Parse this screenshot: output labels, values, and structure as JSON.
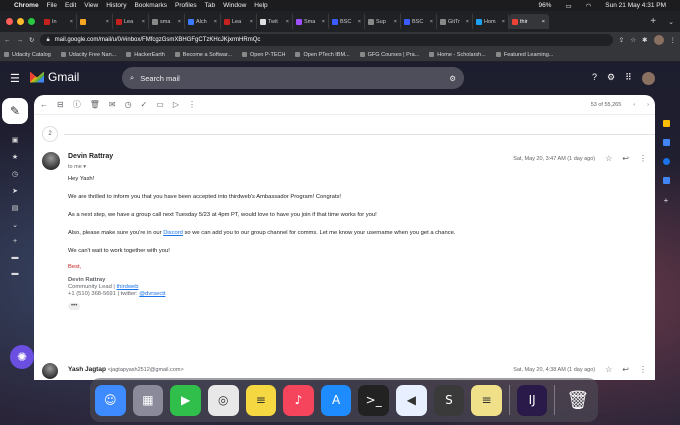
{
  "menubar": {
    "app": "Chrome",
    "items": [
      "File",
      "Edit",
      "View",
      "History",
      "Bookmarks",
      "Profiles",
      "Tab",
      "Window",
      "Help"
    ],
    "battery": "96%",
    "datetime": "Sun 21 May  4:31 PM"
  },
  "tabs": [
    {
      "label": "In",
      "color": "#c5221f"
    },
    {
      "label": "",
      "color": "#f5a623"
    },
    {
      "label": "Lea",
      "color": "#c5221f"
    },
    {
      "label": "sma",
      "color": "#888888"
    },
    {
      "label": "Alch",
      "color": "#3b7bff"
    },
    {
      "label": "Lea",
      "color": "#c5221f"
    },
    {
      "label": "Twit",
      "color": "#e0e0e0"
    },
    {
      "label": "Sma",
      "color": "#a050ff"
    },
    {
      "label": "BSC",
      "color": "#3b5bff"
    },
    {
      "label": "Sup",
      "color": "#888888"
    },
    {
      "label": "BSC",
      "color": "#3b5bff"
    },
    {
      "label": "GitTr",
      "color": "#888888"
    },
    {
      "label": "Hom",
      "color": "#1da1f2"
    },
    {
      "label": "thir",
      "color": "#ea4335",
      "active": true
    }
  ],
  "address": {
    "url": "mail.google.com/mail/u/0/#inbox/FMfcgzGsmXBHGFgCTzKHcJKjxrmHRmQc"
  },
  "bookmarks": [
    "Udacity Catalog",
    "Udacity Free Nan...",
    "HackerEarth",
    "Become a Softwar...",
    "Open P-TECH",
    "Open PTech IBM...",
    "GFG Courses | Pra...",
    "Home - Scholarsh...",
    "Featured Learning..."
  ],
  "gmail": {
    "brand": "Gmail",
    "search_placeholder": "Search mail",
    "pagination": "53 of 55,265",
    "collapsed_count": "2"
  },
  "message": {
    "sender": "Devin Rattray",
    "to": "to me",
    "date": "Sat, May 20, 3:47 AM (1 day ago)",
    "greeting": "Hey Yash!",
    "p1": "We are thrilled to inform you that you have been accepted into thirdweb's Ambassador Program! Congrats!",
    "p2": "As a next step, we have a group call next Tuesday 5/23 at 4pm PT, would love to have you join if that time works for you!",
    "p3_before": "Also, please make sure you're in our ",
    "p3_link": "Discord",
    "p3_after": " so we can add you to our group channel for comms. Let me know your username when you get a chance.",
    "p4": "We can't wait to work together with you!",
    "closing": "Best,",
    "sig_name": "Devin Rattray",
    "sig_role_prefix": "Community Lead | ",
    "sig_company": "thirdweb",
    "sig_phone_prefix": "+1 (510) 368-5691 | twitter: ",
    "sig_twitter": "@dvrsectt",
    "ellipsis": "•••"
  },
  "message2": {
    "sender": "Yash Jagtap",
    "email": "<jagtapyash2512@gmail.com>",
    "date": "Sat, May 20, 4:38 AM (1 day ago)"
  },
  "dock": [
    {
      "name": "finder",
      "color": "#3d8bff",
      "glyph": "☺"
    },
    {
      "name": "launchpad",
      "color": "#8a8a9a",
      "glyph": "▦"
    },
    {
      "name": "facetime",
      "color": "#2fbf4a",
      "glyph": "▶"
    },
    {
      "name": "chrome",
      "color": "#e8e8e8",
      "glyph": "◎"
    },
    {
      "name": "notes",
      "color": "#f5d742",
      "glyph": "≡"
    },
    {
      "name": "music",
      "color": "#f5455c",
      "glyph": "♪"
    },
    {
      "name": "app-store",
      "color": "#1e8cff",
      "glyph": "A"
    },
    {
      "name": "terminal",
      "color": "#222222",
      "glyph": ">_"
    },
    {
      "name": "vscode",
      "color": "#e8f0ff",
      "glyph": "◀"
    },
    {
      "name": "sublime",
      "color": "#3a3a3a",
      "glyph": "S"
    },
    {
      "name": "stickies",
      "color": "#f0e08a",
      "glyph": "≡"
    },
    {
      "name": "intellij",
      "color": "#2a1a4a",
      "glyph": "IJ"
    }
  ]
}
